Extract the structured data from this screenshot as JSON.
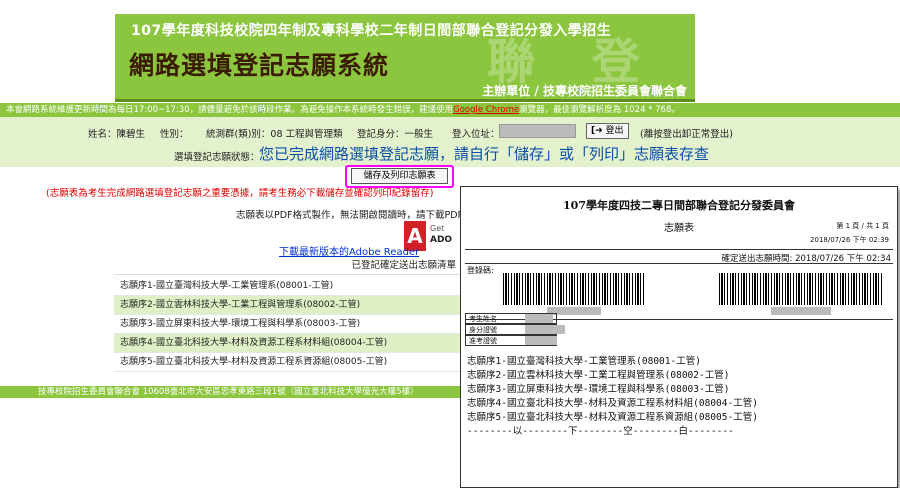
{
  "banner": {
    "subtitle": "107學年度科技校院四年制及專科學校二年制日間部聯合登記分發入學招生",
    "title": "網路選填登記志願系統",
    "watermark": "聯 登",
    "organizer": "主辦單位 / 技專校院招生委員會聯合會"
  },
  "notice": {
    "text": "本會網路系統維護更新時間為每日17:00~17:30，請儘量避免於該時段作業。為避免操作本系統時發生錯誤，建議使用",
    "browser_link": "Google Chrome",
    "text_after": "瀏覽器，最佳瀏覽解析度為 1024 * 768。"
  },
  "user": {
    "name_label": "姓名：",
    "name_value": "陳碧生",
    "gender_label": "性別：",
    "group_label": "統測群(類)別：",
    "group_value": "08 工程與管理類",
    "identity_label": "登記身分：",
    "identity_value": "一般生",
    "ip_label": "登入位址：",
    "logout_label": "登出",
    "logout_note": "(離按登出卸正常登出)"
  },
  "status": {
    "label": "選填登記志願狀態：",
    "message": "您已完成網路選填登記志願，請自行「儲存」或「列印」志願表存查"
  },
  "print_button_label": "儲存及列印志願表",
  "warning_text": "(志願表為考生完成網路選填登記志願之重要憑據，請考生務必下載儲存並確認列印紀錄留存)",
  "pdf_note": "志願表以PDF格式製作，無法開啟閱讀時，請下載PDF",
  "adobe": {
    "letter": "A",
    "get": "Get",
    "name": "ADO"
  },
  "download_link": "下載最新版本的Adobe Reader",
  "list": {
    "header": "已登記確定送出志願清單",
    "items": [
      "志願序1-國立臺灣科技大學-工業管理系(08001-工管)",
      "志願序2-國立雲林科技大學-工業工程與管理系(08002-工管)",
      "志願序3-國立屏東科技大學-環境工程與科學系(08003-工管)",
      "志願序4-國立臺北科技大學-材料及資源工程系材料組(08004-工管)",
      "志願序5-國立臺北科技大學-材料及資源工程系資源組(08005-工管)"
    ]
  },
  "footer": "技專校院招生委員會聯合會 10608臺北市大安區忠孝東路三段1號（國立臺北科技大學億光大樓5樓）",
  "preview": {
    "title": "107學年度四技二專日間部聯合登記分發委員會",
    "subtitle": "志願表",
    "page": "第 1 頁 / 共 1 頁",
    "date": "2018/07/26 下午 02:39",
    "confirm": "確定送出志願時間: 2018/07/26 下午 02:34",
    "reg_label": "登錄碼:",
    "fields": [
      "考生姓名",
      "身分證號",
      "准考證號"
    ],
    "items": [
      "志願序1-國立臺灣科技大學-工業管理系(08001-工管)",
      "志願序2-國立雲林科技大學-工業工程與管理系(08002-工管)",
      "志願序3-國立屏東科技大學-環境工程與科學系(08003-工管)",
      "志願序4-國立臺北科技大學-材料及資源工程系材料組(08004-工管)",
      "志願序5-國立臺北科技大學-材料及資源工程系資源組(08005-工管)"
    ],
    "end_line": "--------以--------下--------空--------白--------"
  }
}
